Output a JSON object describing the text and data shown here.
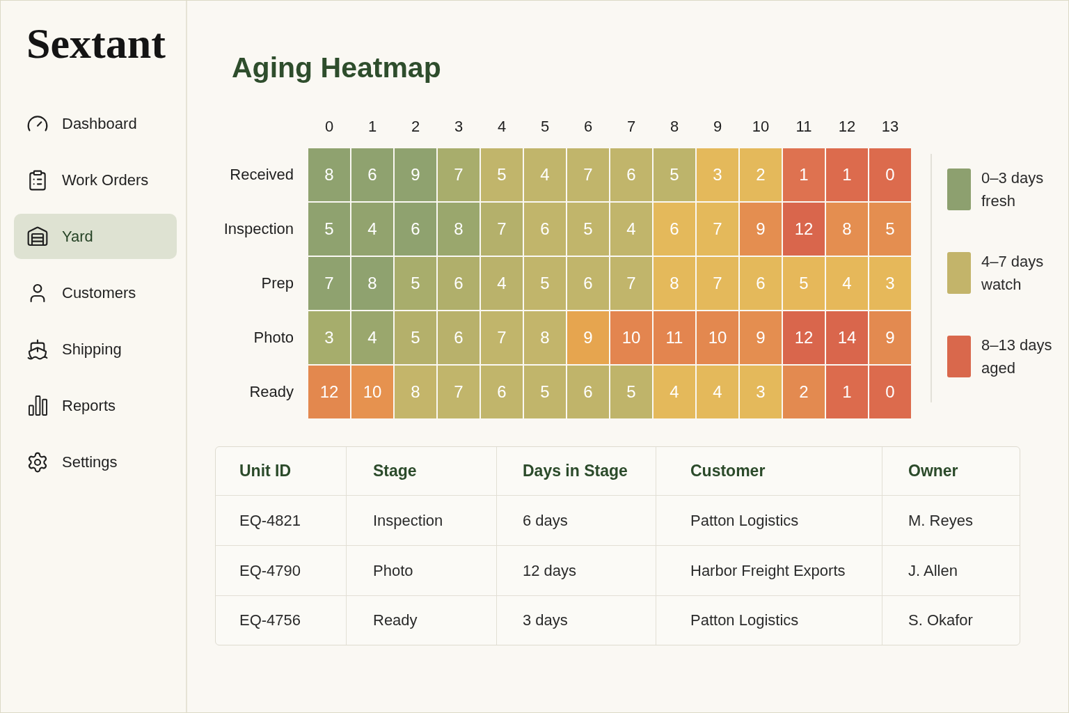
{
  "sidebar": {
    "logo": "Sextant",
    "items": [
      {
        "label": "Dashboard",
        "selected": false
      },
      {
        "label": "Work Orders",
        "selected": false
      },
      {
        "label": "Yard",
        "selected": true
      },
      {
        "label": "Customers",
        "selected": false
      },
      {
        "label": "Shipping",
        "selected": false
      },
      {
        "label": "Reports",
        "selected": false
      },
      {
        "label": "Settings",
        "selected": false
      }
    ]
  },
  "page": {
    "title": "Aging Heatmap"
  },
  "heatmap": {
    "columns": [
      "0",
      "1",
      "2",
      "3",
      "4",
      "5",
      "6",
      "7",
      "8",
      "9",
      "10",
      "11",
      "12",
      "13"
    ],
    "rows": [
      {
        "label": "Received",
        "cells": [
          {
            "value": "8",
            "color": "#8fa26f"
          },
          {
            "value": "6",
            "color": "#8fa26f"
          },
          {
            "value": "9",
            "color": "#8fa26f"
          },
          {
            "value": "7",
            "color": "#a8ad6c"
          },
          {
            "value": "5",
            "color": "#c1b56b"
          },
          {
            "value": "4",
            "color": "#c1b56b"
          },
          {
            "value": "7",
            "color": "#c1b56b"
          },
          {
            "value": "6",
            "color": "#c1b56b"
          },
          {
            "value": "5",
            "color": "#bdb46b"
          },
          {
            "value": "3",
            "color": "#e4b95b"
          },
          {
            "value": "2",
            "color": "#e4b95b"
          },
          {
            "value": "1",
            "color": "#de7250"
          },
          {
            "value": "1",
            "color": "#dc6b4d"
          },
          {
            "value": "0",
            "color": "#dc6b4d"
          }
        ]
      },
      {
        "label": "Inspection",
        "cells": [
          {
            "value": "5",
            "color": "#8fa26f"
          },
          {
            "value": "4",
            "color": "#92a36e"
          },
          {
            "value": "6",
            "color": "#8fa26f"
          },
          {
            "value": "8",
            "color": "#9aa76d"
          },
          {
            "value": "7",
            "color": "#b4b06b"
          },
          {
            "value": "6",
            "color": "#c1b56b"
          },
          {
            "value": "5",
            "color": "#c1b56b"
          },
          {
            "value": "4",
            "color": "#c1b56b"
          },
          {
            "value": "6",
            "color": "#e4b95b"
          },
          {
            "value": "7",
            "color": "#e4b95b"
          },
          {
            "value": "9",
            "color": "#e48e50"
          },
          {
            "value": "12",
            "color": "#d9664c"
          },
          {
            "value": "8",
            "color": "#e48e50"
          },
          {
            "value": "5",
            "color": "#e48e50"
          }
        ]
      },
      {
        "label": "Prep",
        "cells": [
          {
            "value": "7",
            "color": "#8fa26f"
          },
          {
            "value": "8",
            "color": "#8fa26f"
          },
          {
            "value": "5",
            "color": "#a8ad6c"
          },
          {
            "value": "6",
            "color": "#b0af6b"
          },
          {
            "value": "4",
            "color": "#bab26b"
          },
          {
            "value": "5",
            "color": "#c1b56b"
          },
          {
            "value": "6",
            "color": "#c1b56b"
          },
          {
            "value": "7",
            "color": "#c1b56b"
          },
          {
            "value": "8",
            "color": "#e4b95b"
          },
          {
            "value": "7",
            "color": "#e4b95b"
          },
          {
            "value": "6",
            "color": "#e4b95b"
          },
          {
            "value": "5",
            "color": "#e6b85a"
          },
          {
            "value": "4",
            "color": "#e6b85a"
          },
          {
            "value": "3",
            "color": "#e6b85a"
          }
        ]
      },
      {
        "label": "Photo",
        "cells": [
          {
            "value": "3",
            "color": "#a6ad6c"
          },
          {
            "value": "4",
            "color": "#9aa76d"
          },
          {
            "value": "5",
            "color": "#b4b06b"
          },
          {
            "value": "6",
            "color": "#b8b16b"
          },
          {
            "value": "7",
            "color": "#c1b56b"
          },
          {
            "value": "8",
            "color": "#c3b56b"
          },
          {
            "value": "9",
            "color": "#e6a54f"
          },
          {
            "value": "10",
            "color": "#e3854f"
          },
          {
            "value": "11",
            "color": "#e3854f"
          },
          {
            "value": "10",
            "color": "#e3884f"
          },
          {
            "value": "9",
            "color": "#e48e50"
          },
          {
            "value": "12",
            "color": "#d9664c"
          },
          {
            "value": "14",
            "color": "#d9664c"
          },
          {
            "value": "9",
            "color": "#e38a50"
          }
        ]
      },
      {
        "label": "Ready",
        "cells": [
          {
            "value": "12",
            "color": "#e3884e"
          },
          {
            "value": "10",
            "color": "#e6924f"
          },
          {
            "value": "8",
            "color": "#c4b56a"
          },
          {
            "value": "7",
            "color": "#c1b56b"
          },
          {
            "value": "6",
            "color": "#c1b56b"
          },
          {
            "value": "5",
            "color": "#c1b56b"
          },
          {
            "value": "6",
            "color": "#c0b46a"
          },
          {
            "value": "5",
            "color": "#bfb46a"
          },
          {
            "value": "4",
            "color": "#e4b95b"
          },
          {
            "value": "4",
            "color": "#e4b95b"
          },
          {
            "value": "3",
            "color": "#e4b95b"
          },
          {
            "value": "2",
            "color": "#e38a50"
          },
          {
            "value": "1",
            "color": "#dc6b4d"
          },
          {
            "value": "0",
            "color": "#dc6b4d"
          }
        ]
      }
    ]
  },
  "legend": [
    {
      "range": "0–3 days",
      "label": "fresh",
      "color": "#8da06f"
    },
    {
      "range": "4–7 days",
      "label": "watch",
      "color": "#c3b46a"
    },
    {
      "range": "8–13 days",
      "label": "aged",
      "color": "#d9684c"
    }
  ],
  "table": {
    "columns": [
      "Unit ID",
      "Stage",
      "Days in Stage",
      "Customer",
      "Owner"
    ],
    "rows": [
      [
        "EQ-4821",
        "Inspection",
        "6 days",
        "Patton Logistics",
        "M. Reyes"
      ],
      [
        "EQ-4790",
        "Photo",
        "12 days",
        "Harbor Freight Exports",
        "J. Allen"
      ],
      [
        "EQ-4756",
        "Ready",
        "3 days",
        "Patton Logistics",
        "S. Okafor"
      ]
    ]
  }
}
